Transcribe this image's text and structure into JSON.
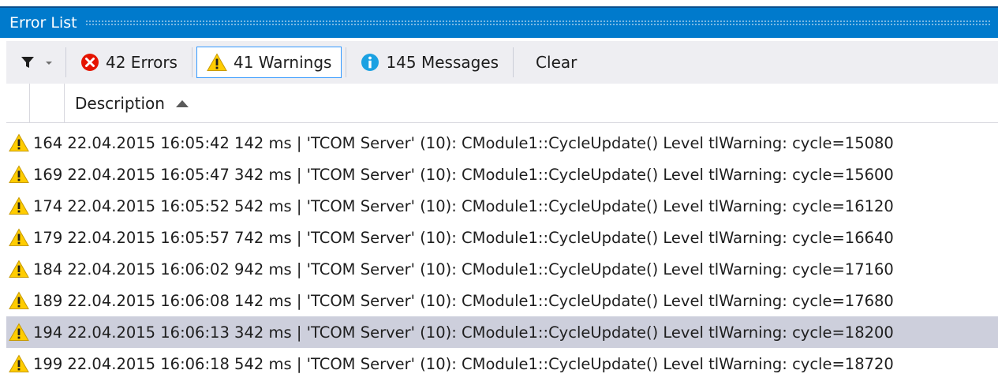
{
  "title": "Error List",
  "toolbar": {
    "errors_label": "42 Errors",
    "warnings_label": "41 Warnings",
    "messages_label": "145 Messages",
    "clear_label": "Clear"
  },
  "header": {
    "description": "Description"
  },
  "rows": [
    {
      "text": "164 22.04.2015 16:05:42 142 ms | 'TCOM Server' (10): CModule1::CycleUpdate() Level tlWarning: cycle=15080",
      "selected": false
    },
    {
      "text": "169 22.04.2015 16:05:47 342 ms | 'TCOM Server' (10): CModule1::CycleUpdate() Level tlWarning: cycle=15600",
      "selected": false
    },
    {
      "text": "174 22.04.2015 16:05:52 542 ms | 'TCOM Server' (10): CModule1::CycleUpdate() Level tlWarning: cycle=16120",
      "selected": false
    },
    {
      "text": "179 22.04.2015 16:05:57 742 ms | 'TCOM Server' (10): CModule1::CycleUpdate() Level tlWarning: cycle=16640",
      "selected": false
    },
    {
      "text": "184 22.04.2015 16:06:02 942 ms | 'TCOM Server' (10): CModule1::CycleUpdate() Level tlWarning: cycle=17160",
      "selected": false
    },
    {
      "text": "189 22.04.2015 16:06:08 142 ms | 'TCOM Server' (10): CModule1::CycleUpdate() Level tlWarning: cycle=17680",
      "selected": false
    },
    {
      "text": "194 22.04.2015 16:06:13 342 ms | 'TCOM Server' (10): CModule1::CycleUpdate() Level tlWarning: cycle=18200",
      "selected": true
    },
    {
      "text": "199 22.04.2015 16:06:18 542 ms | 'TCOM Server' (10): CModule1::CycleUpdate() Level tlWarning: cycle=18720",
      "selected": false
    }
  ],
  "icons": {
    "filter": "filter-icon",
    "dropdown": "chevron-down-icon",
    "error": "error-icon",
    "warning": "warning-icon",
    "info": "info-icon",
    "sort": "sort-ascending-icon"
  },
  "colors": {
    "titlebar": "#007acc",
    "toolbar": "#eeeef2",
    "active_border": "#3399ff",
    "selected_row": "#cdcfdc",
    "error": "#e51400",
    "warning": "#ffcc00",
    "info": "#1ba1e2"
  }
}
